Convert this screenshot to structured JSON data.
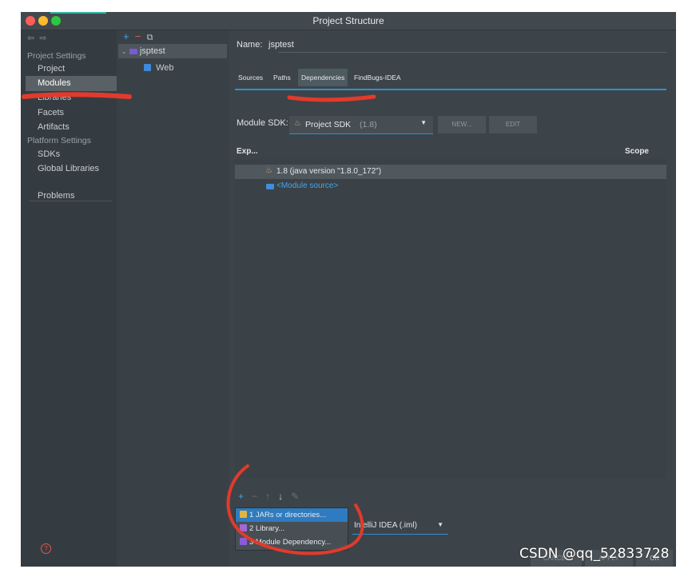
{
  "window": {
    "title": "Project Structure"
  },
  "sidebar": {
    "project_settings_header": "Project Settings",
    "items_top": [
      "Project",
      "Modules",
      "Libraries",
      "Facets",
      "Artifacts"
    ],
    "platform_settings_header": "Platform Settings",
    "items_platform": [
      "SDKs",
      "Global Libraries"
    ],
    "problems": "Problems"
  },
  "tree": {
    "add": "+",
    "remove": "−",
    "copy": "⧉",
    "module": "jsptest",
    "facet": "Web"
  },
  "module": {
    "name_label": "Name:",
    "name_value": "jsptest",
    "tabs": [
      "Sources",
      "Paths",
      "Dependencies",
      "FindBugs-IDEA"
    ],
    "sdk_label": "Module SDK:",
    "sdk_value": "Project SDK",
    "sdk_version": "(1.8)",
    "new_button": "NEW...",
    "edit_button": "EDIT",
    "col_export": "Exp...",
    "col_scope": "Scope",
    "dependencies": [
      {
        "label": "1.8 (java version \"1.8.0_172\")"
      },
      {
        "label": "<Module source>"
      }
    ]
  },
  "bottom": {
    "add": "+",
    "remove": "−",
    "up": "↑",
    "down": "↓",
    "edit": "✎",
    "menu": [
      "1 JARs or directories...",
      "2 Library...",
      "3 Module Dependency..."
    ],
    "format_value": "IntelliJ IDEA (.iml)",
    "cancel": "CANCEL",
    "apply": "APPLY",
    "ok": "OK"
  },
  "help_icon": "?",
  "watermark": "CSDN @qq_52833728",
  "colors": {
    "accent_blue": "#2f8fd0",
    "selection": "#2f7bc0",
    "annotation_red": "#e23a2c",
    "link_blue": "#4aa3e8"
  }
}
